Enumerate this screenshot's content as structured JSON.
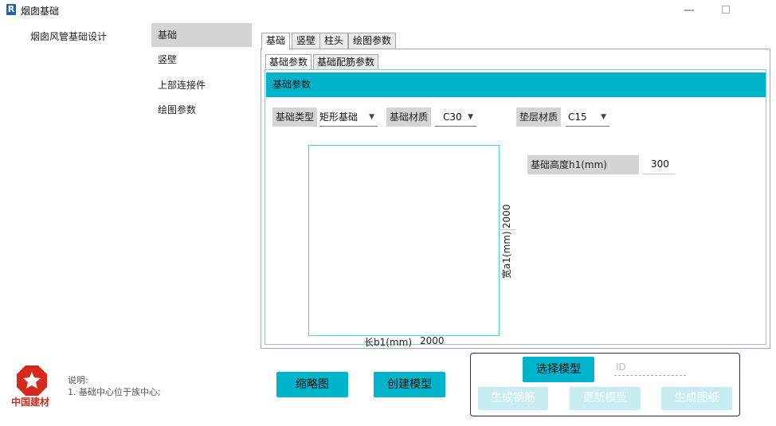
{
  "window": {
    "title": "烟囱基础",
    "app_icon": "R",
    "icon_names": [
      "revit-app-icon",
      "minimize-icon",
      "maximize-icon"
    ]
  },
  "tree": {
    "root": "烟囱风管基础设计",
    "items": [
      {
        "label": "基础",
        "active": true
      },
      {
        "label": "竖壁",
        "active": false
      },
      {
        "label": "上部连接件",
        "active": false
      },
      {
        "label": "绘图参数",
        "active": false
      }
    ]
  },
  "tabs": [
    {
      "label": "基础",
      "active": true
    },
    {
      "label": "竖壁",
      "active": false
    },
    {
      "label": "柱头",
      "active": false
    },
    {
      "label": "绘图参数",
      "active": false
    }
  ],
  "subtabs": [
    {
      "label": "基础参数",
      "active": true
    },
    {
      "label": "基础配筋参数",
      "active": false
    }
  ],
  "section": {
    "title": "基础参数",
    "foundation_type_label": "基础类型",
    "foundation_type_value": "矩形基础",
    "foundation_material_label": "基础材质",
    "foundation_material_value": "C30",
    "cushion_material_label": "垫层材质",
    "cushion_material_value": "C15",
    "height_label": "基础高度h1(mm)",
    "height_value": "300",
    "width_label": "宽a1(mm)",
    "width_value": "2000",
    "length_label": "长b1(mm)",
    "length_value": "2000"
  },
  "footer": {
    "logo_text": "中国建材",
    "note_title": "说明:",
    "note_line1": "1. 基础中心位于族中心;",
    "thumbnail_button": "缩略图",
    "create_model_button": "创建模型",
    "select_model_button": "选择模型",
    "id_placeholder": "ID",
    "gen_rebar_button": "生成钢筋",
    "update_model_button": "更新模型",
    "gen_drawing_button": "生成图纸"
  },
  "colors": {
    "accent": "#00b4cc",
    "accent_disabled": "#c7edf3",
    "drawing_outline": "#40d8e8",
    "label_bg": "#d4d4d4",
    "logo_red": "#d8281e"
  }
}
